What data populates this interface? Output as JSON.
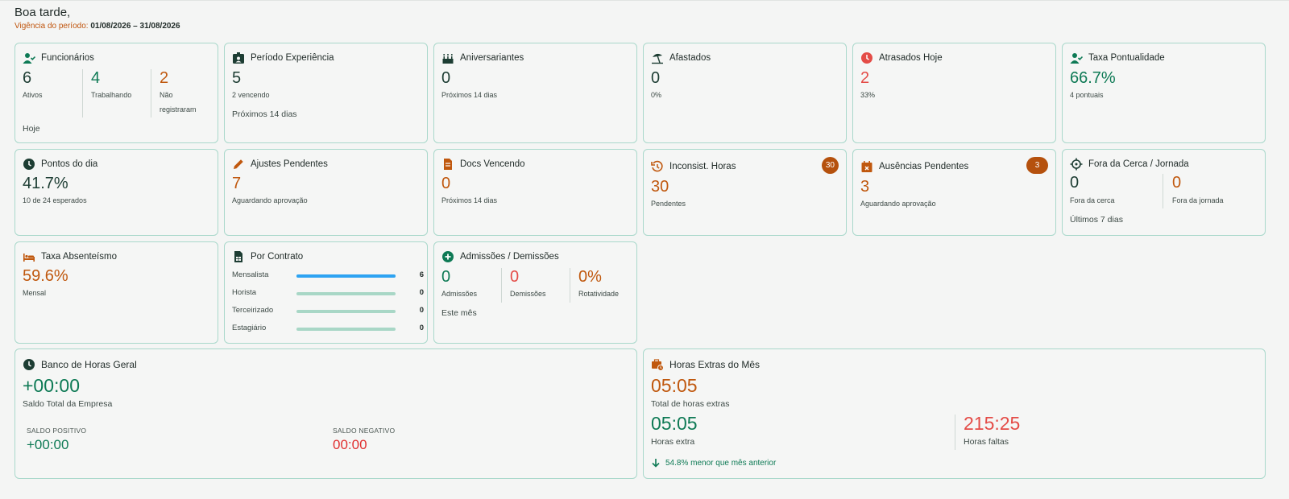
{
  "header": {
    "greeting": "Boa tarde,",
    "period_label": "Vigência do período:",
    "period_value": "01/08/2026 – 31/08/2026"
  },
  "colors": {
    "accent_green": "#0e7a55",
    "accent_orange": "#c0580e",
    "accent_red": "#e44c47",
    "badge": "#b5510d",
    "card_border": "#a9d8cb"
  },
  "funcionarios": {
    "title": "Funcionários",
    "icon": "user-check-icon",
    "ativos_value": "6",
    "ativos_label": "Ativos",
    "trabalhando_value": "4",
    "trabalhando_label": "Trabalhando",
    "nao_value": "2",
    "nao_label_1": "Não",
    "nao_label_2": "registraram",
    "foot": "Hoje"
  },
  "experiencia": {
    "title": "Período Experiência",
    "icon": "id-badge-icon",
    "value": "5",
    "sub": "2 vencendo",
    "foot": "Próximos 14 dias"
  },
  "aniversariantes": {
    "title": "Aniversariantes",
    "icon": "cake-icon",
    "value": "0",
    "sub": "Próximos 14 dias"
  },
  "afastados": {
    "title": "Afastados",
    "icon": "beach-umbrella-icon",
    "value": "0",
    "sub": "0%"
  },
  "atrasados": {
    "title": "Atrasados Hoje",
    "icon": "clock-alert-icon",
    "value": "2",
    "sub": "33%"
  },
  "pontualidade": {
    "title": "Taxa Pontualidade",
    "icon": "user-check-icon",
    "value": "66.7%",
    "sub": "4 pontuais"
  },
  "pontos": {
    "title": "Pontos do dia",
    "icon": "clock-icon",
    "value": "41.7%",
    "sub": "10 de 24 esperados"
  },
  "ajustes": {
    "title": "Ajustes Pendentes",
    "icon": "pencil-icon",
    "value": "7",
    "sub": "Aguardando aprovação"
  },
  "docs": {
    "title": "Docs Vencendo",
    "icon": "document-icon",
    "value": "0",
    "sub": "Próximos 14 dias"
  },
  "inconsist": {
    "title": "Inconsist. Horas",
    "icon": "history-icon",
    "badge": "30",
    "value": "30",
    "sub": "Pendentes"
  },
  "ausencias": {
    "title": "Ausências Pendentes",
    "icon": "calendar-x-icon",
    "badge": "3",
    "value": "3",
    "sub": "Aguardando aprovação"
  },
  "cerca": {
    "title": "Fora da Cerca / Jornada",
    "icon": "crosshair-icon",
    "cerca_value": "0",
    "cerca_label": "Fora da cerca",
    "jornada_value": "0",
    "jornada_label": "Fora da jornada",
    "foot": "Últimos 7 dias"
  },
  "absenteismo": {
    "title": "Taxa Absenteísmo",
    "icon": "bed-icon",
    "value": "59.6%",
    "sub": "Mensal"
  },
  "contrato": {
    "title": "Por Contrato",
    "icon": "file-sheet-icon",
    "rows": [
      {
        "label": "Mensalista",
        "value": "6",
        "fraction": 1.0
      },
      {
        "label": "Horista",
        "value": "0",
        "fraction": 0
      },
      {
        "label": "Terceirizado",
        "value": "0",
        "fraction": 0
      },
      {
        "label": "Estagiário",
        "value": "0",
        "fraction": 0
      }
    ]
  },
  "admissoes": {
    "title": "Admissões / Demissões",
    "icon": "plus-circle-icon",
    "adm_value": "0",
    "adm_label": "Admissões",
    "dem_value": "0",
    "dem_label": "Demissões",
    "rot_value": "0%",
    "rot_label": "Rotatividade",
    "foot": "Este mês"
  },
  "banco": {
    "title": "Banco de Horas Geral",
    "icon": "clock-icon",
    "value": "+00:00",
    "sub": "Saldo Total da Empresa",
    "pos_label": "SALDO POSITIVO",
    "pos_value": "+00:00",
    "neg_label": "SALDO NEGATIVO",
    "neg_value": "00:00"
  },
  "extras": {
    "title": "Horas Extras do Mês",
    "icon": "briefcase-clock-icon",
    "total_value": "05:05",
    "total_label": "Total de horas extras",
    "extra_value": "05:05",
    "extra_label": "Horas extra",
    "faltas_value": "215:25",
    "faltas_label": "Horas faltas",
    "trend_icon": "arrow-down-icon",
    "trend_text": "54.8% menor que mês anterior"
  }
}
